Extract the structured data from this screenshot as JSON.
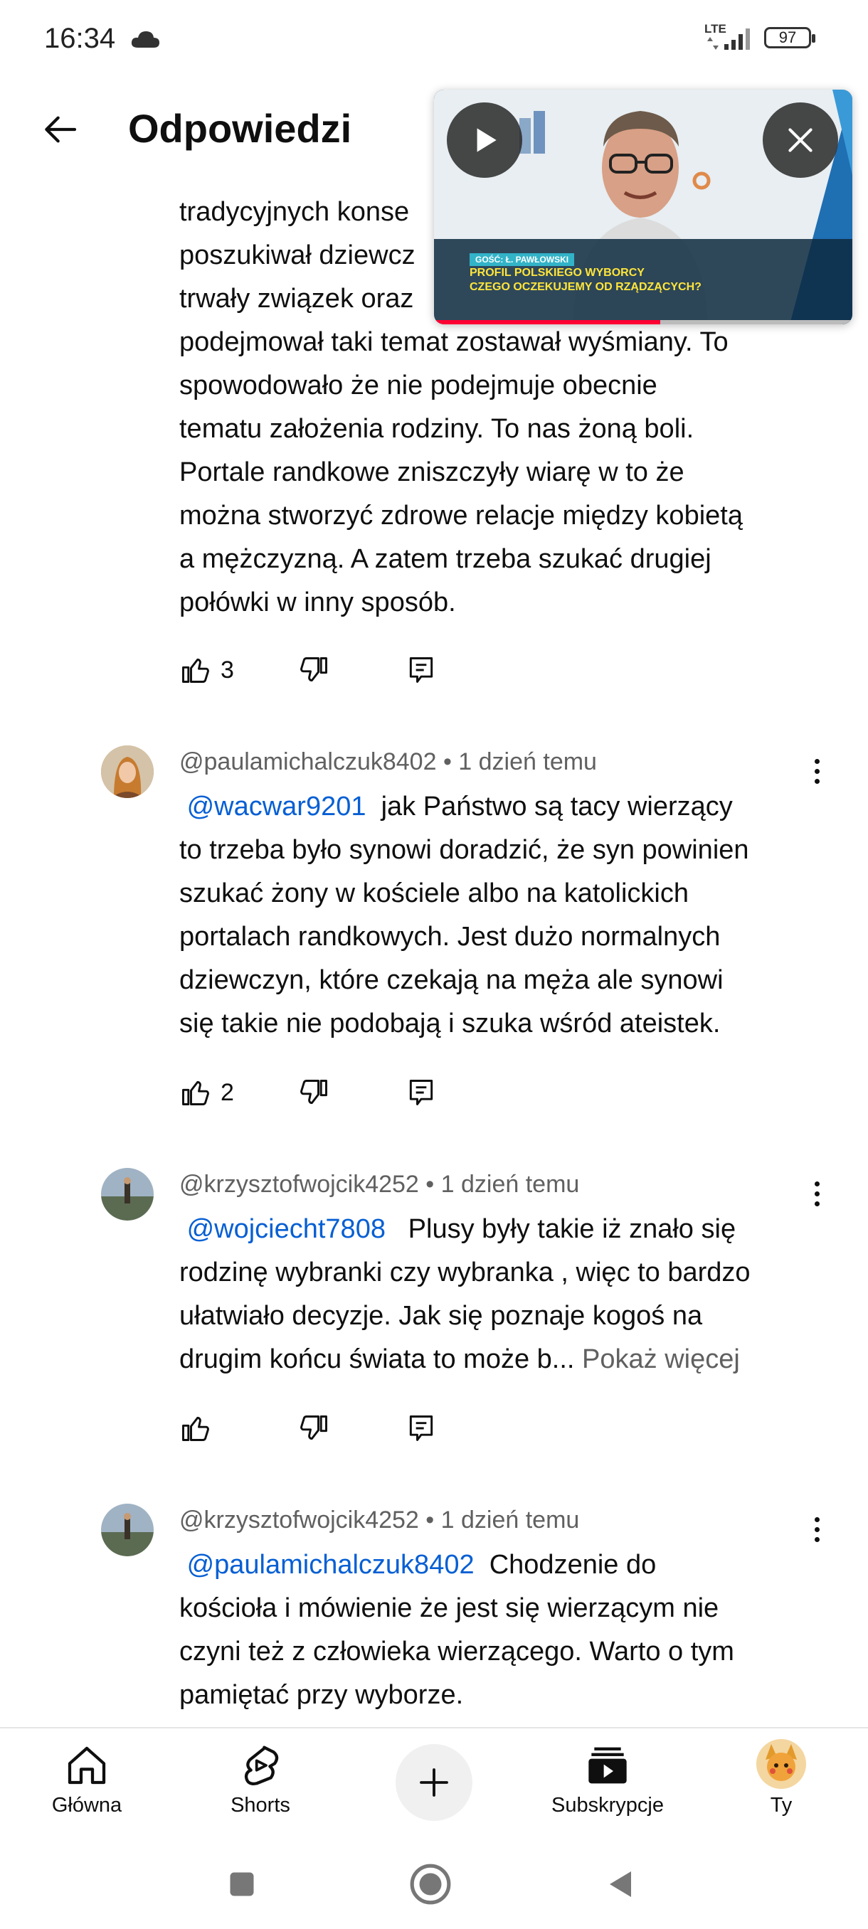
{
  "status_bar": {
    "time": "16:34",
    "network": "LTE",
    "battery": "97"
  },
  "header": {
    "title": "Odpowiedzi"
  },
  "mini_player": {
    "badge": "GOŚĆ: Ł. PAWŁOWSKI",
    "caption_line1": "PROFIL POLSKIEGO WYBORCY",
    "caption_line2": "CZEGO OCZEKUJEMY OD RZĄDZĄCYCH?",
    "progress": 0.54
  },
  "comments": [
    {
      "lines": [
        "tradycyjnych konse",
        "poszukiwał dziewcz",
        "trwały związek oraz",
        "podejmował taki temat zostawał wyśmiany. To",
        "spowodowało że nie podejmuje obecnie",
        "tematu założenia rodziny. To nas żoną boli.",
        "Portale randkowe zniszczyły wiarę w to że",
        "można stworzyć zdrowe relacje między kobietą",
        "a mężczyzną. A zatem trzeba szukać drugiej",
        "połówki w inny sposób."
      ],
      "likes": "3"
    },
    {
      "author": "@paulamichalczuk8402",
      "time": "1 dzień temu",
      "mention": "@wacwar9201",
      "first_line": "jak Państwo są tacy wierzący",
      "lines": [
        "to trzeba było synowi doradzić, że syn powinien",
        "szukać żony w kościele albo na katolickich",
        "portalach randkowych. Jest dużo normalnych",
        "dziewczyn, które czekają na męża ale synowi",
        "się takie nie podobają i szuka wśród ateistek."
      ],
      "likes": "2"
    },
    {
      "author": "@krzysztofwojcik4252",
      "time": "1 dzień temu",
      "mention": "@wojciecht7808",
      "first_line": "Plusy były takie iż znało się",
      "lines": [
        "rodzinę wybranki czy wybranka , więc to bardzo",
        "ułatwiało decyzje. Jak się poznaje kogoś na"
      ],
      "last_line": "drugim końcu świata to może b...",
      "show_more": "Pokaż więcej",
      "likes": ""
    },
    {
      "author": "@krzysztofwojcik4252",
      "time": "1 dzień temu",
      "mention": "@paulamichalczuk8402",
      "first_line": "Chodzenie do",
      "lines": [
        "kościoła i mówienie że jest się wierzącym nie",
        "czyni też z człowieka wierzącego. Warto o tym",
        "pamiętać przy wyborze."
      ]
    }
  ],
  "bottom_nav": {
    "home": "Główna",
    "shorts": "Shorts",
    "subscriptions": "Subskrypcje",
    "you": "Ty"
  },
  "icons": [
    "back-arrow-icon",
    "thumb-up-icon",
    "thumb-down-icon",
    "reply-icon",
    "more-vert-icon",
    "home-icon",
    "shorts-icon",
    "plus-icon",
    "subscriptions-icon",
    "play-icon",
    "close-icon",
    "cloud-icon",
    "signal-icon"
  ],
  "colors": {
    "mention": "#065fd4",
    "meta": "#606060",
    "progress": "#ff0033"
  }
}
